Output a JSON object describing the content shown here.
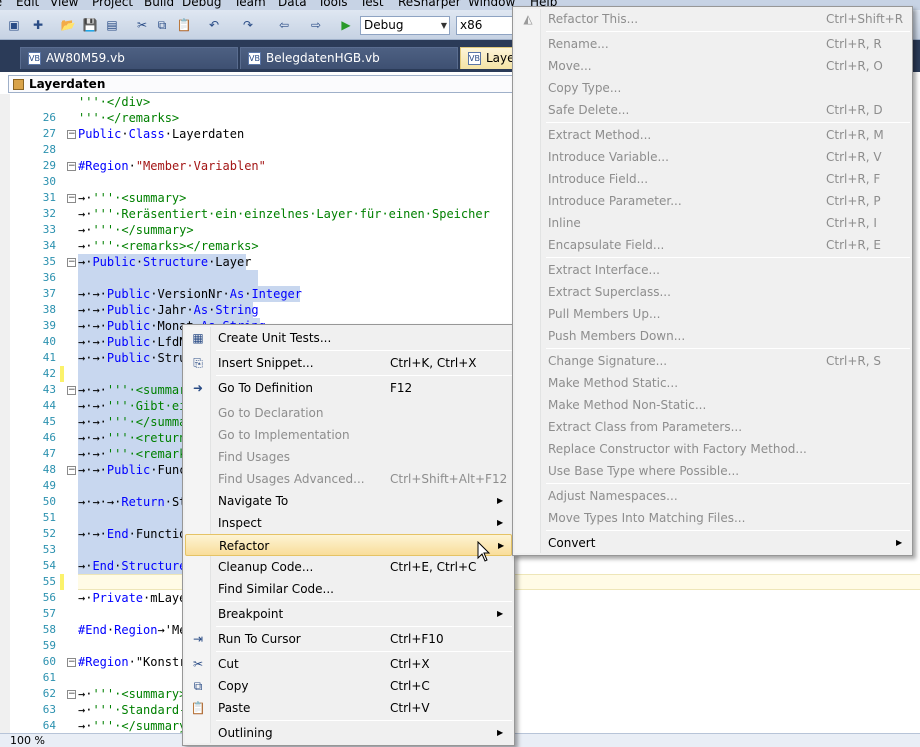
{
  "menubar": [
    "File",
    "Edit",
    "View",
    "Project",
    "Build",
    "Debug",
    "Team",
    "Data",
    "Tools",
    "Test",
    "ReSharper",
    "Window",
    "Help"
  ],
  "toolbar": {
    "config": "Debug",
    "platform": "x86"
  },
  "tabs": [
    {
      "label": "AW80M59.vb"
    },
    {
      "label": "BelegdatenHGB.vb"
    },
    {
      "label": "Laye"
    }
  ],
  "editor": {
    "nav_title": "Layerdaten",
    "lines": [
      {
        "num": "",
        "text": "'''·</div>"
      },
      {
        "num": "26",
        "text": "'''·</remarks>"
      },
      {
        "num": "27",
        "text": "Public·Class·Layerdaten"
      },
      {
        "num": "28",
        "text": ""
      },
      {
        "num": "29",
        "text": "#Region·\"Member·Variablen\""
      },
      {
        "num": "30",
        "text": ""
      },
      {
        "num": "31",
        "text": "→·'''·<summary>"
      },
      {
        "num": "32",
        "text": "→·'''·Reräsentiert·ein·einzelnes·Layer·für·einen·Speicher"
      },
      {
        "num": "33",
        "text": "→·'''·</summary>"
      },
      {
        "num": "34",
        "text": "→·'''·<remarks></remarks>"
      },
      {
        "num": "35",
        "text": "→·Public·Structure·Layer"
      },
      {
        "num": "36",
        "text": ""
      },
      {
        "num": "37",
        "text": "→·→·Public·VersionNr·As·Integer"
      },
      {
        "num": "38",
        "text": "→·→·Public·Jahr·As·String"
      },
      {
        "num": "39",
        "text": "→·→·Public·Monat·As·String"
      },
      {
        "num": "40",
        "text": "→·→·Public·LfdN"
      },
      {
        "num": "41",
        "text": "→·→·Public·Stru"
      },
      {
        "num": "42",
        "text": ""
      },
      {
        "num": "43",
        "text": "→·→·'''·<summar"
      },
      {
        "num": "44",
        "text": "→·→·'''·Gibt·ei"
      },
      {
        "num": "45",
        "text": "→·→·'''·</summa"
      },
      {
        "num": "46",
        "text": "→·→·'''·<return"
      },
      {
        "num": "47",
        "text": "→·→·'''·<remark"
      },
      {
        "num": "48",
        "text": "→·→·Public·Func"
      },
      {
        "num": "49",
        "text": ""
      },
      {
        "num": "50",
        "text": "→·→·→·Return·St"
      },
      {
        "num": "51",
        "text": ""
      },
      {
        "num": "52",
        "text": "→·→·End·Functio"
      },
      {
        "num": "53",
        "text": ""
      },
      {
        "num": "54",
        "text": "→·End·Structure"
      },
      {
        "num": "55",
        "text": ""
      },
      {
        "num": "56",
        "text": "→·Private·mLaye"
      },
      {
        "num": "57",
        "text": ""
      },
      {
        "num": "58",
        "text": "#End·Region→'Me"
      },
      {
        "num": "59",
        "text": ""
      },
      {
        "num": "60",
        "text": "#Region·\"Konstr"
      },
      {
        "num": "61",
        "text": ""
      },
      {
        "num": "62",
        "text": "→·'''·<summary>"
      },
      {
        "num": "63",
        "text": "→·'''·Standard-"
      },
      {
        "num": "64",
        "text": "→·'''·</summary"
      }
    ]
  },
  "status": {
    "zoom": "100 %"
  },
  "context_menu": {
    "items": [
      {
        "label": "Create Unit Tests...",
        "shortcut": "",
        "icon": "unit-test-icon",
        "disabled": false,
        "submenu": false
      },
      {
        "label": "Insert Snippet...",
        "shortcut": "Ctrl+K, Ctrl+X",
        "icon": "snippet-icon",
        "disabled": false,
        "submenu": false
      },
      {
        "label": "Go To Definition",
        "shortcut": "F12",
        "icon": "goto-definition-icon",
        "disabled": false,
        "submenu": false
      },
      {
        "label": "Go to Declaration",
        "shortcut": "",
        "icon": "",
        "disabled": true,
        "submenu": false
      },
      {
        "label": "Go to Implementation",
        "shortcut": "",
        "icon": "",
        "disabled": true,
        "submenu": false
      },
      {
        "label": "Find Usages",
        "shortcut": "",
        "icon": "",
        "disabled": true,
        "submenu": false
      },
      {
        "label": "Find Usages Advanced...",
        "shortcut": "Ctrl+Shift+Alt+F12",
        "icon": "",
        "disabled": true,
        "submenu": false
      },
      {
        "label": "Navigate To",
        "shortcut": "",
        "icon": "",
        "disabled": false,
        "submenu": true
      },
      {
        "label": "Inspect",
        "shortcut": "",
        "icon": "",
        "disabled": false,
        "submenu": true
      },
      {
        "label": "Refactor",
        "shortcut": "",
        "icon": "",
        "disabled": false,
        "submenu": true,
        "highlighted": true
      },
      {
        "label": "Cleanup Code...",
        "shortcut": "Ctrl+E, Ctrl+C",
        "icon": "",
        "disabled": false,
        "submenu": false
      },
      {
        "label": "Find Similar Code...",
        "shortcut": "",
        "icon": "",
        "disabled": false,
        "submenu": false
      },
      {
        "label": "Breakpoint",
        "shortcut": "",
        "icon": "",
        "disabled": false,
        "submenu": true
      },
      {
        "label": "Run To Cursor",
        "shortcut": "Ctrl+F10",
        "icon": "run-to-cursor-icon",
        "disabled": false,
        "submenu": false
      },
      {
        "label": "Cut",
        "shortcut": "Ctrl+X",
        "icon": "scissors-icon",
        "disabled": false,
        "submenu": false
      },
      {
        "label": "Copy",
        "shortcut": "Ctrl+C",
        "icon": "copy-icon",
        "disabled": false,
        "submenu": false
      },
      {
        "label": "Paste",
        "shortcut": "Ctrl+V",
        "icon": "paste-icon",
        "disabled": false,
        "submenu": false
      },
      {
        "label": "Outlining",
        "shortcut": "",
        "icon": "",
        "disabled": false,
        "submenu": true
      }
    ]
  },
  "refactor_menu": {
    "items": [
      {
        "label": "Refactor This...",
        "shortcut": "Ctrl+Shift+R",
        "disabled": true,
        "submenu": false
      },
      {
        "label": "Rename...",
        "shortcut": "Ctrl+R, R",
        "disabled": true,
        "submenu": false
      },
      {
        "label": "Move...",
        "shortcut": "Ctrl+R, O",
        "disabled": true,
        "submenu": false
      },
      {
        "label": "Copy Type...",
        "shortcut": "",
        "disabled": true,
        "submenu": false
      },
      {
        "label": "Safe Delete...",
        "shortcut": "Ctrl+R, D",
        "disabled": true,
        "submenu": false
      },
      {
        "label": "Extract Method...",
        "shortcut": "Ctrl+R, M",
        "disabled": true,
        "submenu": false
      },
      {
        "label": "Introduce Variable...",
        "shortcut": "Ctrl+R, V",
        "disabled": true,
        "submenu": false
      },
      {
        "label": "Introduce Field...",
        "shortcut": "Ctrl+R, F",
        "disabled": true,
        "submenu": false
      },
      {
        "label": "Introduce Parameter...",
        "shortcut": "Ctrl+R, P",
        "disabled": true,
        "submenu": false
      },
      {
        "label": "Inline",
        "shortcut": "Ctrl+R, I",
        "disabled": true,
        "submenu": false
      },
      {
        "label": "Encapsulate Field...",
        "shortcut": "Ctrl+R, E",
        "disabled": true,
        "submenu": false
      },
      {
        "label": "Extract Interface...",
        "shortcut": "",
        "disabled": true,
        "submenu": false
      },
      {
        "label": "Extract Superclass...",
        "shortcut": "",
        "disabled": true,
        "submenu": false
      },
      {
        "label": "Pull Members Up...",
        "shortcut": "",
        "disabled": true,
        "submenu": false
      },
      {
        "label": "Push Members Down...",
        "shortcut": "",
        "disabled": true,
        "submenu": false
      },
      {
        "label": "Change Signature...",
        "shortcut": "Ctrl+R, S",
        "disabled": true,
        "submenu": false
      },
      {
        "label": "Make Method Static...",
        "shortcut": "",
        "disabled": true,
        "submenu": false
      },
      {
        "label": "Make Method Non-Static...",
        "shortcut": "",
        "disabled": true,
        "submenu": false
      },
      {
        "label": "Extract Class from Parameters...",
        "shortcut": "",
        "disabled": true,
        "submenu": false
      },
      {
        "label": "Replace Constructor with Factory Method...",
        "shortcut": "",
        "disabled": true,
        "submenu": false
      },
      {
        "label": "Use Base Type where Possible...",
        "shortcut": "",
        "disabled": true,
        "submenu": false
      },
      {
        "label": "Adjust Namespaces...",
        "shortcut": "",
        "disabled": true,
        "submenu": false
      },
      {
        "label": "Move Types Into Matching Files...",
        "shortcut": "",
        "disabled": true,
        "submenu": false
      },
      {
        "label": "Convert",
        "shortcut": "",
        "disabled": false,
        "submenu": true
      }
    ]
  },
  "colors": {
    "ide_background": "#2b3b58",
    "menu_background": "#f0f0f0",
    "highlight": "#f9dd9a",
    "selection": "#c8d7ef",
    "keyword": "#0000ff",
    "comment": "#008000",
    "line_number": "#2b91af"
  }
}
